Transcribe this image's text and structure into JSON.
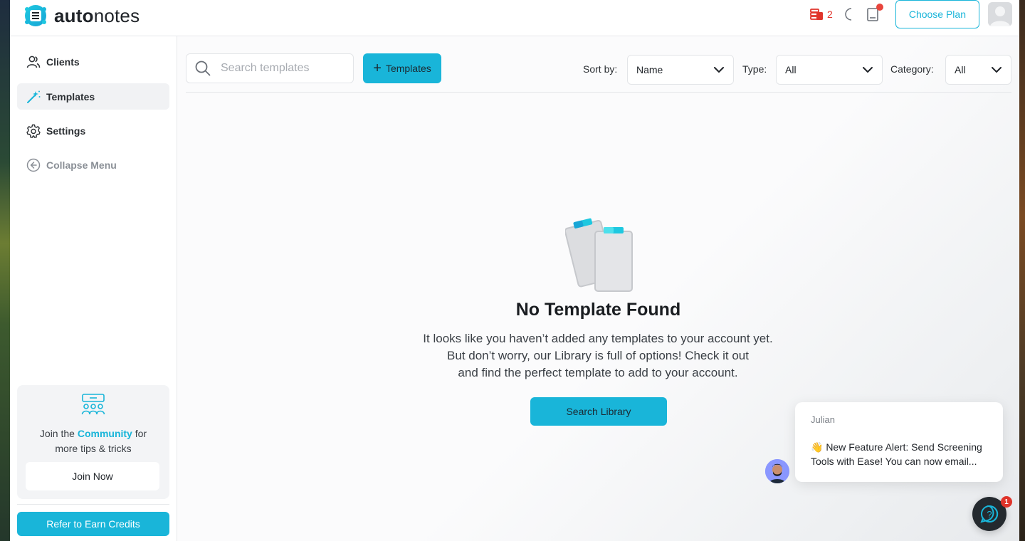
{
  "app": {
    "name_bold": "auto",
    "name_rest": "notes"
  },
  "header": {
    "credits_count": "2",
    "choose_plan_label": "Choose Plan",
    "icons": [
      "credits-icon",
      "moon-icon",
      "notes-icon",
      "avatar"
    ],
    "accent_color": "#19b5d9",
    "notification_color": "#e8453c"
  },
  "sidebar": {
    "items": [
      {
        "label": "Clients",
        "icon": "users-icon",
        "active": false
      },
      {
        "label": "Templates",
        "icon": "magic-wand-icon",
        "active": true
      },
      {
        "label": "Settings",
        "icon": "gear-icon",
        "active": false
      },
      {
        "label": "Collapse Menu",
        "icon": "arrow-left-circle-icon",
        "active": false
      }
    ],
    "community": {
      "prefix": "Join the ",
      "link": "Community",
      "suffix": " for",
      "line2": "more tips & tricks",
      "join_label": "Join Now"
    },
    "refer_label": "Refer to Earn Credits"
  },
  "toolbar": {
    "search_placeholder": "Search templates",
    "add_label": "Templates",
    "sort_label": "Sort by:",
    "sort_value": "Name",
    "type_label": "Type:",
    "type_value": "All",
    "category_label": "Category:",
    "category_value": "All"
  },
  "empty_state": {
    "title": "No Template Found",
    "line1": "It looks like you haven’t added any templates to your account yet.",
    "line2": "But don’t worry, our Library is full of options! Check it out",
    "line3": "and find the perfect template to add to your account.",
    "button_label": "Search Library"
  },
  "chat": {
    "sender": "Julian",
    "message": "👋 New Feature Alert: Send Screening Tools with Ease! You can now email...",
    "badge_count": "1"
  }
}
